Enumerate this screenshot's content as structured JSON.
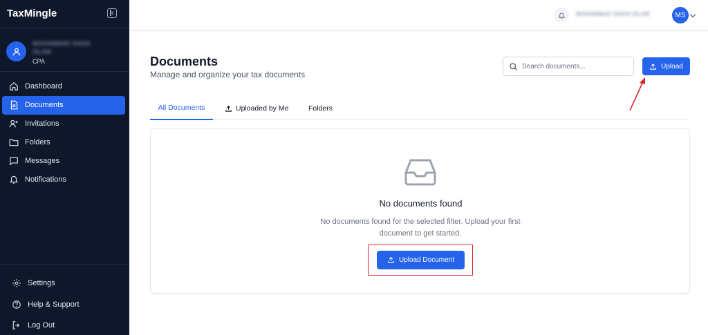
{
  "app": {
    "name": "TaxMingle"
  },
  "user": {
    "name": "MOHAMMAD SADIA ISLAM",
    "role": "CPA",
    "initials": "MS"
  },
  "sidebar": {
    "items": [
      {
        "label": "Dashboard",
        "icon": "home-icon"
      },
      {
        "label": "Documents",
        "icon": "document-icon",
        "active": true
      },
      {
        "label": "Invitations",
        "icon": "user-plus-icon"
      },
      {
        "label": "Folders",
        "icon": "folder-icon"
      },
      {
        "label": "Messages",
        "icon": "message-icon"
      },
      {
        "label": "Notifications",
        "icon": "bell-icon"
      }
    ],
    "bottom": [
      {
        "label": "Settings",
        "icon": "gear-icon"
      },
      {
        "label": "Help & Support",
        "icon": "help-icon"
      },
      {
        "label": "Log Out",
        "icon": "logout-icon"
      }
    ]
  },
  "header": {
    "user_name": "MOHAMMAD SADIA ISLAM",
    "initials": "MS"
  },
  "main": {
    "title": "Documents",
    "subtitle": "Manage and organize your tax documents",
    "search_placeholder": "Search documents...",
    "upload_label": "Upload",
    "tabs": [
      {
        "label": "All Documents",
        "active": true
      },
      {
        "label": "Uploaded by Me"
      },
      {
        "label": "Folders"
      }
    ],
    "empty": {
      "title": "No documents found",
      "text": "No documents found for the selected filter. Upload your first document to get started.",
      "button": "Upload Document"
    }
  },
  "colors": {
    "accent": "#2563eb",
    "sidebar_bg": "#0f172a",
    "annotation": "#dc2626"
  }
}
